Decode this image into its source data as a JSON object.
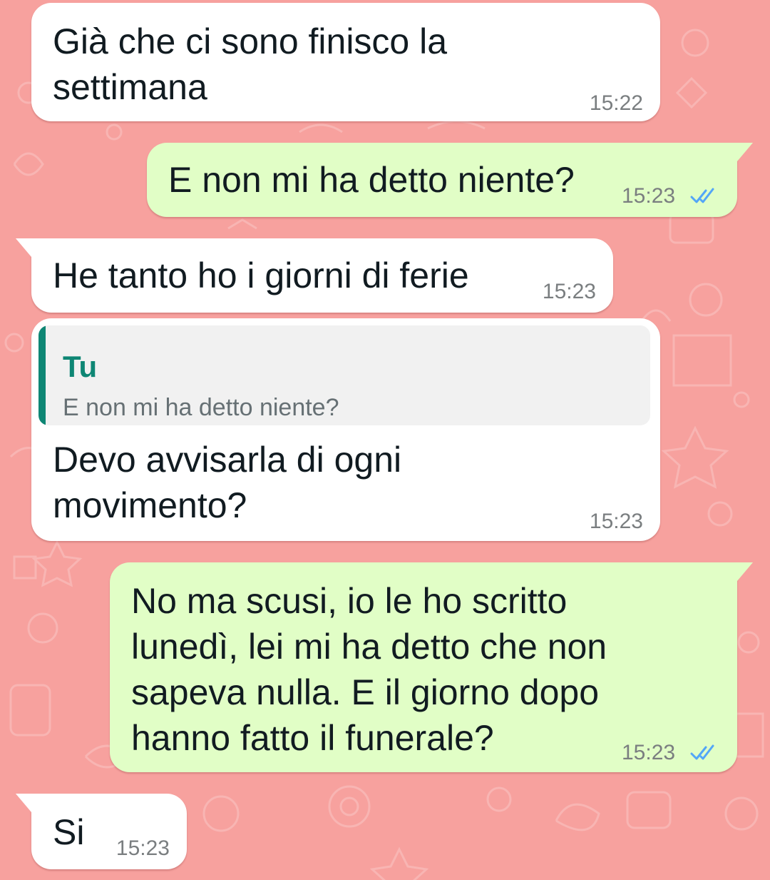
{
  "theme": {
    "wallpaper_color": "#f7a19e",
    "incoming_bubble_color": "#ffffff",
    "outgoing_bubble_color": "#e1fec6",
    "read_tick_color": "#53a6f7",
    "quote_accent_color": "#0e8674"
  },
  "messages": [
    {
      "direction": "incoming",
      "text": "Già che ci sono finisco la\nsettimana",
      "time": "15:22"
    },
    {
      "direction": "outgoing",
      "text": "E non mi ha detto niente?",
      "time": "15:23",
      "status": "read"
    },
    {
      "direction": "incoming",
      "text": "He tanto ho i giorni di ferie",
      "time": "15:23"
    },
    {
      "direction": "incoming",
      "quoted": {
        "author": "Tu",
        "text": "E non mi ha detto niente?"
      },
      "text": "Devo avvisarla di ogni\nmovimento?",
      "time": "15:23"
    },
    {
      "direction": "outgoing",
      "text": "No ma scusi, io le ho scritto\nlunedì, lei mi ha detto che non\nsapeva nulla. E il giorno dopo\nhanno fatto il funerale?",
      "time": "15:23",
      "status": "read"
    },
    {
      "direction": "incoming",
      "text": "Si",
      "time": "15:23"
    }
  ],
  "icons": {
    "read_receipt": "double-check-icon"
  }
}
